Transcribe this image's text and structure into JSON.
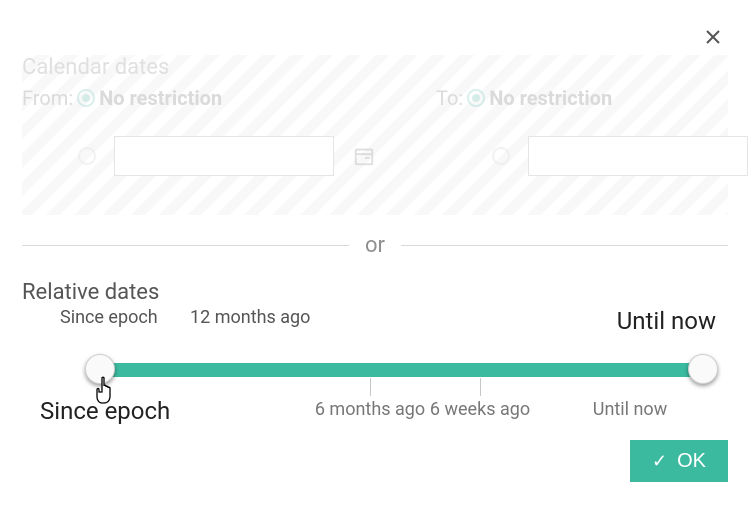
{
  "close": {
    "icon": "close-icon"
  },
  "calendar": {
    "title": "Calendar dates",
    "from": {
      "label": "From:",
      "no_restriction": "No restriction",
      "input_value": ""
    },
    "to": {
      "label": "To:",
      "no_restriction": "No restriction",
      "input_value": ""
    }
  },
  "divider": {
    "or": "or"
  },
  "relative": {
    "title": "Relative dates",
    "top_left": "Since epoch",
    "top_mid": "12 months ago",
    "top_right": "Until now",
    "bottom_left_big": "Since epoch",
    "ticks": {
      "six_months": "6 months ago",
      "six_weeks": "6 weeks ago",
      "until_now": "Until now"
    }
  },
  "ok": {
    "label": "OK"
  }
}
